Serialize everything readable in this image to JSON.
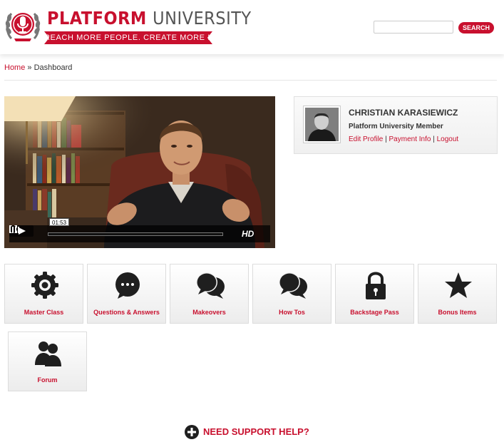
{
  "header": {
    "logo_title_part1": "PLATFORM",
    "logo_title_part2": "UNIVERSITY",
    "logo_tagline": "REACH MORE PEOPLE. CREATE MORE IMPACT.",
    "search_placeholder": "",
    "search_button_label": "SEARCH"
  },
  "breadcrumb": {
    "home": "Home",
    "separator": " » ",
    "current": "Dashboard"
  },
  "video": {
    "timestamp": "01:53",
    "hd_label": "HD",
    "progress": 0.0
  },
  "profile": {
    "name": "CHRISTIAN KARASIEWICZ",
    "role": "Platform University Member",
    "edit_profile": "Edit Profile",
    "payment_info": "Payment Info",
    "logout": "Logout",
    "link_separator": " | "
  },
  "tiles": [
    {
      "label": "Master Class",
      "icon": "gear-icon"
    },
    {
      "label": "Questions & Answers",
      "icon": "speech-bubble-icon"
    },
    {
      "label": "Makeovers",
      "icon": "chat-bubbles-icon"
    },
    {
      "label": "How Tos",
      "icon": "chat-bubbles-icon"
    },
    {
      "label": "Backstage Pass",
      "icon": "lock-icon"
    },
    {
      "label": "Bonus Items",
      "icon": "star-icon"
    },
    {
      "label": "Forum",
      "icon": "users-icon"
    }
  ],
  "support": {
    "label": "NEED SUPPORT HELP?",
    "icon": "plus-circle-icon"
  },
  "colors": {
    "brand_red": "#c8102e",
    "icon_dark": "#1f1f1f"
  }
}
